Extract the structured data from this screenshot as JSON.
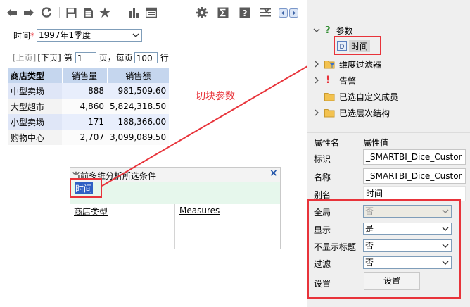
{
  "toolbar": {
    "icons": [
      "back-arrow-icon",
      "forward-arrow-icon",
      "refresh-icon",
      "save-icon",
      "save-as-icon",
      "favorite-star-icon",
      "chart-icon",
      "layout-icon",
      "gear-icon",
      "sigma-icon",
      "help-icon",
      "clear-filter-icon",
      "prev-icon",
      "next-icon"
    ]
  },
  "filter": {
    "label": "时间",
    "required_mark": "*",
    "value": "1997年1季度"
  },
  "pager": {
    "prev": "[上页]",
    "next": "[下页]",
    "page_prefix": "第",
    "page_value": "1",
    "page_suffix": "页，每页",
    "per_page_value": "100",
    "per_page_suffix": "行"
  },
  "table": {
    "headers": [
      "商店类型",
      "销售量",
      "销售额"
    ],
    "rows": [
      [
        "中型卖场",
        "888",
        "981,509.60"
      ],
      [
        "大型超市",
        "4,860",
        "5,824,318.50"
      ],
      [
        "小型卖场",
        "171",
        "188,366.00"
      ],
      [
        "购物中心",
        "2,707",
        "3,099,089.50"
      ]
    ]
  },
  "annotation": {
    "text": "切块参数"
  },
  "conditions_panel": {
    "title": "当前多维分析所选条件",
    "selected": "时间",
    "col1": "商店类型",
    "col2": "Measures"
  },
  "tree": {
    "params_label": "参数",
    "time_label": "时间",
    "items": [
      "维度过滤器",
      "告警",
      "已选自定义成员",
      "已选层次结构"
    ]
  },
  "properties": {
    "header_name": "属性名",
    "header_value": "属性值",
    "rows": [
      {
        "label": "标识",
        "value": "_SMARTBI_Dice_Custor"
      },
      {
        "label": "名称",
        "value": "_SMARTBI_Dice_Custor"
      },
      {
        "label": "别名",
        "value": "时间"
      }
    ],
    "selects": [
      {
        "label": "全局",
        "value": "否"
      },
      {
        "label": "显示",
        "value": "是"
      },
      {
        "label": "不显示标题",
        "value": "否"
      },
      {
        "label": "过滤",
        "value": "否"
      }
    ],
    "settings_label": "设置",
    "settings_button": "设置"
  },
  "colors": {
    "highlight_red": "#e8333a",
    "header_bg": "#c5d6ee",
    "row_bg": "#dfe6f7",
    "selected_bg": "#e6f7ec"
  }
}
